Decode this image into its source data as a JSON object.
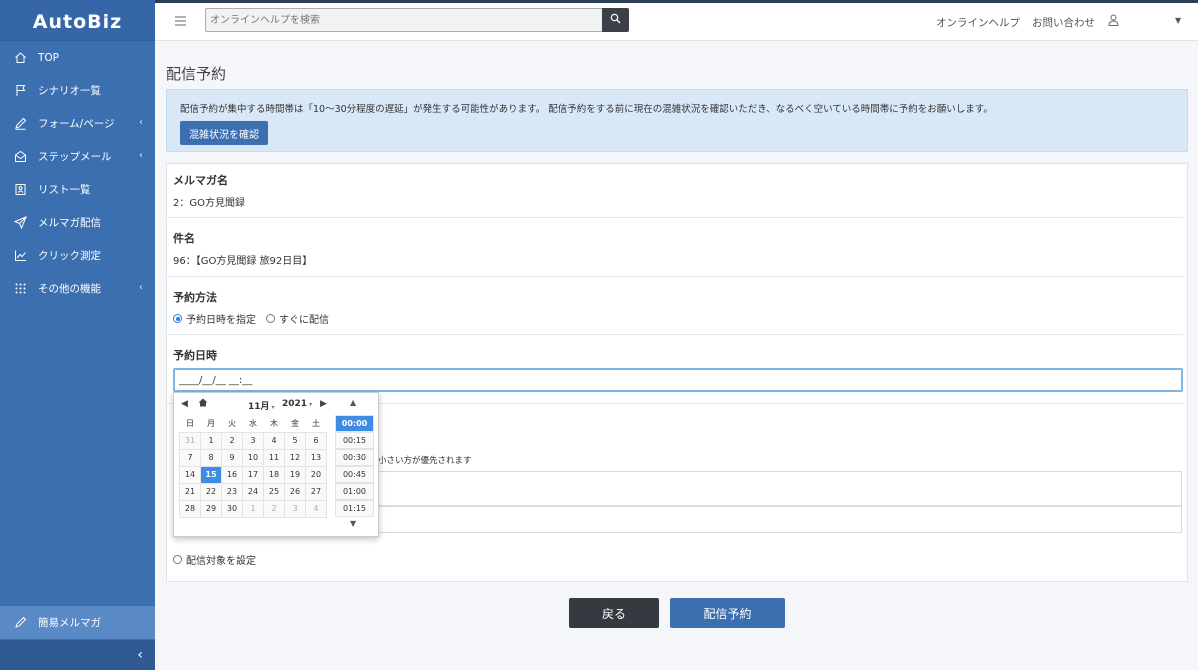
{
  "app": {
    "logo": "AutoBiz"
  },
  "sidebar": {
    "items": [
      {
        "label": "TOP",
        "icon": "home-icon"
      },
      {
        "label": "シナリオ一覧",
        "icon": "flag-icon"
      },
      {
        "label": "フォーム/ページ",
        "icon": "pen-icon",
        "chevron": "‹"
      },
      {
        "label": "ステップメール",
        "icon": "mail-icon",
        "chevron": "‹"
      },
      {
        "label": "リスト一覧",
        "icon": "list-icon"
      },
      {
        "label": "メルマガ配信",
        "icon": "send-icon"
      },
      {
        "label": "クリック測定",
        "icon": "chart-icon"
      },
      {
        "label": "その他の機能",
        "icon": "grid-icon",
        "chevron": "‹"
      }
    ],
    "active_item": {
      "label": "簡易メルマガ",
      "icon": "pencil-icon"
    },
    "collapse_label": "‹"
  },
  "header": {
    "search_placeholder": "オンラインヘルプを検索",
    "help_link": "オンラインヘルプ",
    "contact_link": "お問い合わせ"
  },
  "page": {
    "title": "配信予約",
    "alert_text": "配信予約が集中する時間帯は「10〜30分程度の遅延」が発生する可能性があります。 配信予約をする前に現在の混雑状況を確認いただき、なるべく空いている時間帯に予約をお願いします。",
    "alert_button": "混雑状況を確認"
  },
  "form": {
    "magazine_label": "メルマガ名",
    "magazine_value": "2：GO方見聞録",
    "subject_label": "件名",
    "subject_value": "96：【GO方見聞録 旅92日目】",
    "method_label": "予約方法",
    "method_options": [
      "予約日時を指定",
      "すぐに配信"
    ],
    "method_selected": "予約日時を指定",
    "datetime_label": "予約日時",
    "datetime_value": "____/__/__ __:__",
    "hint_fragment": "小さい方が優先されます",
    "target_option": "配信対象を設定"
  },
  "buttons": {
    "back": "戻る",
    "submit": "配信予約"
  },
  "datepicker": {
    "month": "11月",
    "year": "2021",
    "weekdays": [
      "日",
      "月",
      "火",
      "水",
      "木",
      "金",
      "土"
    ],
    "weeks": [
      [
        "31",
        "1",
        "2",
        "3",
        "4",
        "5",
        "6"
      ],
      [
        "7",
        "8",
        "9",
        "10",
        "11",
        "12",
        "13"
      ],
      [
        "14",
        "15",
        "16",
        "17",
        "18",
        "19",
        "20"
      ],
      [
        "21",
        "22",
        "23",
        "24",
        "25",
        "26",
        "27"
      ],
      [
        "28",
        "29",
        "30",
        "1",
        "2",
        "3",
        "4"
      ]
    ],
    "selected_day": "15",
    "times": [
      "00:00",
      "00:15",
      "00:30",
      "00:45",
      "01:00",
      "01:15"
    ],
    "selected_time": "00:00",
    "accent_color": "#3d8ce6"
  }
}
